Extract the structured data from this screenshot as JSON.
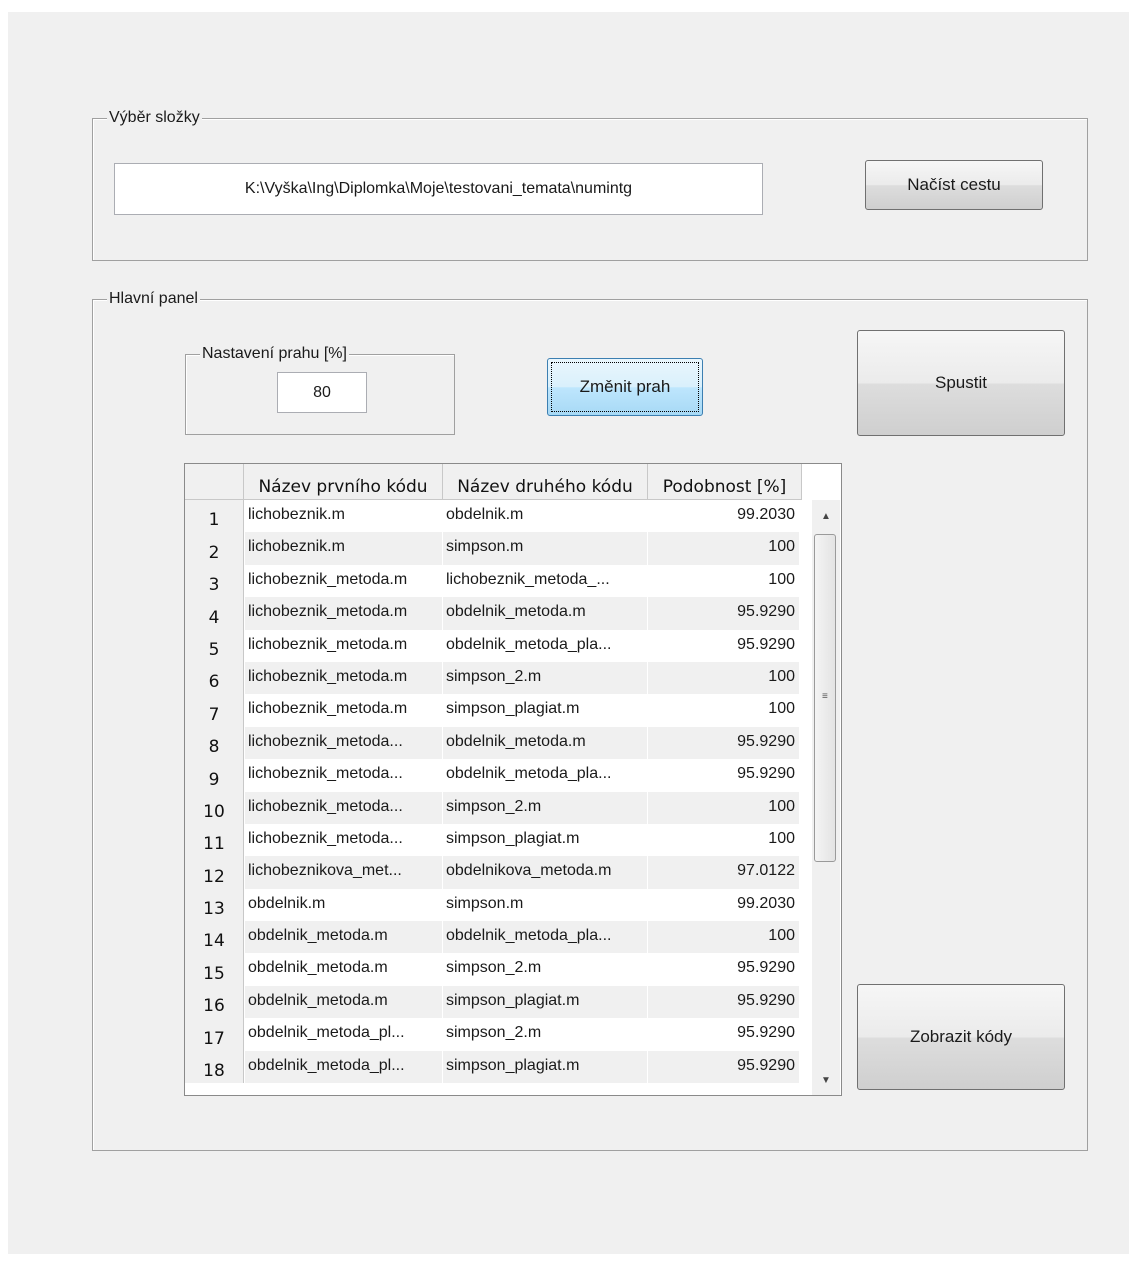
{
  "folder_panel": {
    "title": "Výběr složky",
    "path_value": "K:\\Vyška\\Ing\\Diplomka\\Moje\\testovani_temata\\numintg",
    "load_button": "Načíst cestu"
  },
  "main_panel": {
    "title": "Hlavní panel",
    "threshold_group_title": "Nastavení prahu [%]",
    "threshold_value": "80",
    "change_threshold_button": "Změnit prah",
    "run_button": "Spustit",
    "show_codes_button": "Zobrazit kódy"
  },
  "table": {
    "columns": [
      "Název prvního kódu",
      "Název druhého kódu",
      "Podobnost [%]"
    ],
    "rows": [
      {
        "n": "1",
        "a": "lichobeznik.m",
        "b": "obdelnik.m",
        "s": "99.2030"
      },
      {
        "n": "2",
        "a": "lichobeznik.m",
        "b": "simpson.m",
        "s": "100"
      },
      {
        "n": "3",
        "a": "lichobeznik_metoda.m",
        "b": "lichobeznik_metoda_...",
        "s": "100"
      },
      {
        "n": "4",
        "a": "lichobeznik_metoda.m",
        "b": "obdelnik_metoda.m",
        "s": "95.9290"
      },
      {
        "n": "5",
        "a": "lichobeznik_metoda.m",
        "b": "obdelnik_metoda_pla...",
        "s": "95.9290"
      },
      {
        "n": "6",
        "a": "lichobeznik_metoda.m",
        "b": "simpson_2.m",
        "s": "100"
      },
      {
        "n": "7",
        "a": "lichobeznik_metoda.m",
        "b": "simpson_plagiat.m",
        "s": "100"
      },
      {
        "n": "8",
        "a": "lichobeznik_metoda...",
        "b": "obdelnik_metoda.m",
        "s": "95.9290"
      },
      {
        "n": "9",
        "a": "lichobeznik_metoda...",
        "b": "obdelnik_metoda_pla...",
        "s": "95.9290"
      },
      {
        "n": "10",
        "a": "lichobeznik_metoda...",
        "b": "simpson_2.m",
        "s": "100"
      },
      {
        "n": "11",
        "a": "lichobeznik_metoda...",
        "b": "simpson_plagiat.m",
        "s": "100"
      },
      {
        "n": "12",
        "a": "lichobeznikova_met...",
        "b": "obdelnikova_metoda.m",
        "s": "97.0122"
      },
      {
        "n": "13",
        "a": "obdelnik.m",
        "b": "simpson.m",
        "s": "99.2030"
      },
      {
        "n": "14",
        "a": "obdelnik_metoda.m",
        "b": "obdelnik_metoda_pla...",
        "s": "100"
      },
      {
        "n": "15",
        "a": "obdelnik_metoda.m",
        "b": "simpson_2.m",
        "s": "95.9290"
      },
      {
        "n": "16",
        "a": "obdelnik_metoda.m",
        "b": "simpson_plagiat.m",
        "s": "95.9290"
      },
      {
        "n": "17",
        "a": "obdelnik_metoda_pl...",
        "b": "simpson_2.m",
        "s": "95.9290"
      },
      {
        "n": "18",
        "a": "obdelnik_metoda_pl...",
        "b": "simpson_plagiat.m",
        "s": "95.9290"
      }
    ]
  },
  "scrollbar": {
    "up_icon": "scroll-up-arrow-icon",
    "down_icon": "scroll-down-arrow-icon",
    "grip_icon": "scroll-grip-icon"
  }
}
